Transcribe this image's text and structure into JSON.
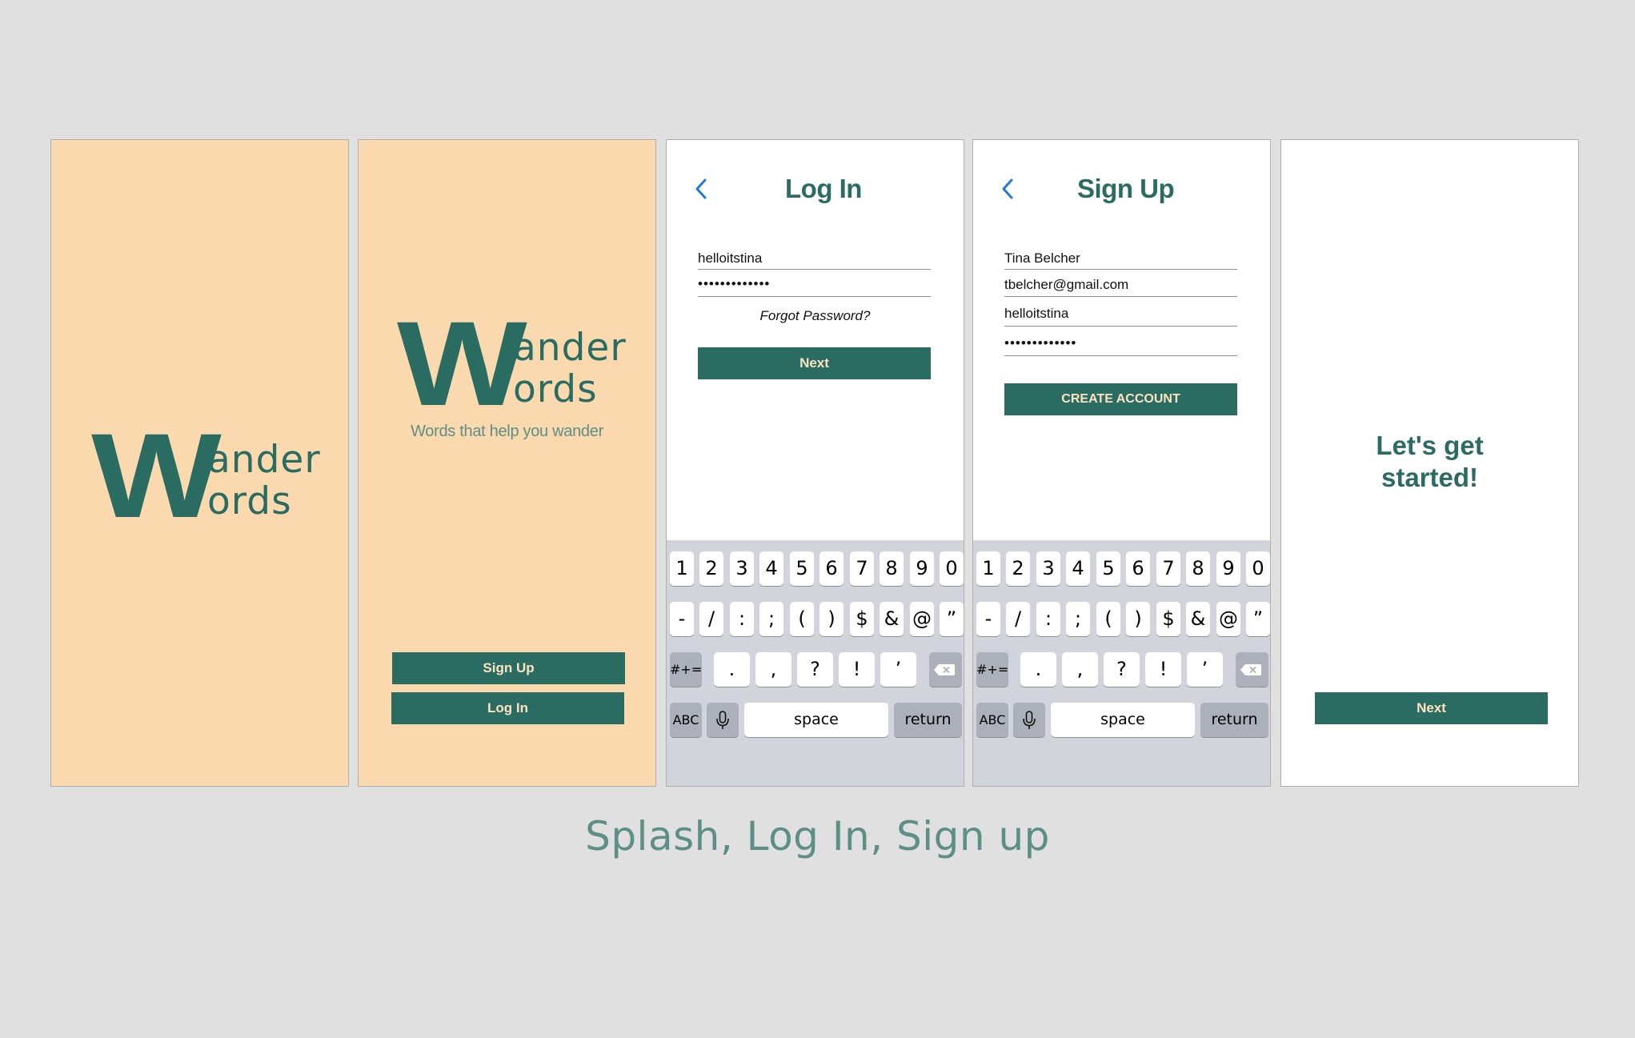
{
  "brand": {
    "logo_initial": "W",
    "logo_line1": "ander",
    "logo_line2": "ords",
    "tagline": "Words that help you wander",
    "primary_color": "#2b6c62",
    "background_peach": "#fad9ae"
  },
  "splash2": {
    "signup_label": "Sign Up",
    "login_label": "Log In"
  },
  "login": {
    "title": "Log In",
    "username_value": "helloitstina",
    "password_value": "•••••••••••••",
    "forgot_label": "Forgot Password?",
    "next_label": "Next"
  },
  "signup": {
    "title": "Sign Up",
    "name_value": "Tina Belcher",
    "email_value": "tbelcher@gmail.com",
    "username_value": "helloitstina",
    "password_value": "•••••••••••••",
    "create_label": "CREATE ACCOUNT"
  },
  "started": {
    "line1": "Let's get",
    "line2": "started!",
    "next_label": "Next"
  },
  "keyboard": {
    "row1": [
      "1",
      "2",
      "3",
      "4",
      "5",
      "6",
      "7",
      "8",
      "9",
      "0"
    ],
    "row2": [
      "-",
      "/",
      ":",
      ";",
      "(",
      ")",
      "$",
      "&",
      "@",
      "”"
    ],
    "row3_toggle": "#+=",
    "row3": [
      ".",
      ",",
      "?",
      "!",
      "’"
    ],
    "abc_label": "ABC",
    "space_label": "space",
    "return_label": "return"
  },
  "caption": "Splash, Log In, Sign up"
}
